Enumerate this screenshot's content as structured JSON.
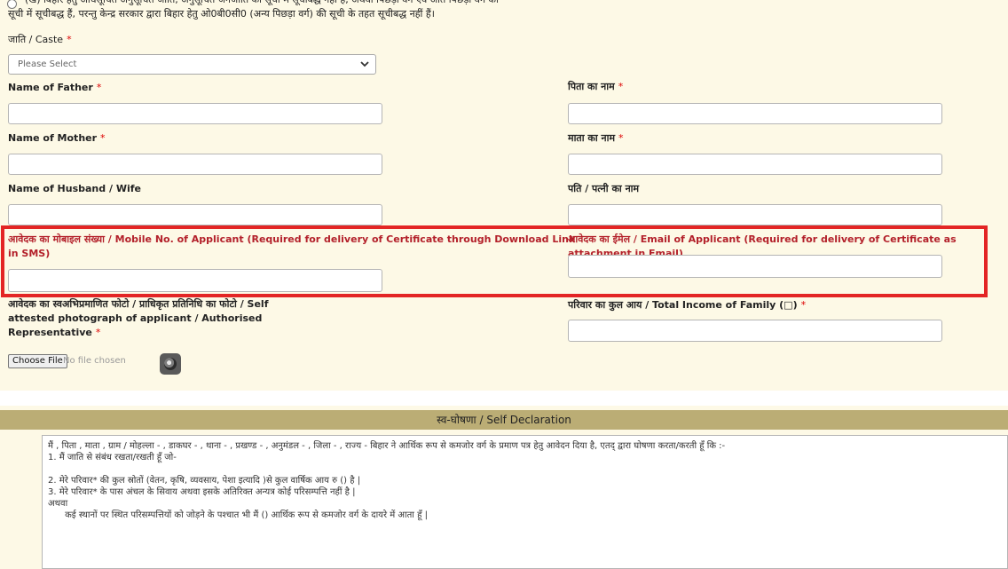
{
  "top_text": {
    "line1": "(ख) बिहार हेतु अधिसूचित अनुसूचित जाति, अनुसूचित जनजाति की सूची में सूचीबद्ध नहीं हैं, अथवा पिछड़ा वर्ग एवं अति पिछड़ा वर्ग की",
    "line2": "सूची में सूचीबद्ध हैं, परन्तु केन्द्र सरकार द्वारा बिहार हेतु ओ0बी0सी0 (अन्य पिछड़ा वर्ग) की सूची के तहत सूचीबद्ध नहीं हैं।"
  },
  "caste": {
    "label": "जाति / Caste",
    "required": "*",
    "placeholder": "Please Select"
  },
  "father": {
    "label_en": "Name of Father",
    "label_hi": "पिता का नाम",
    "required": "*",
    "value_en": "",
    "value_hi": ""
  },
  "mother": {
    "label_en": "Name of Mother",
    "label_hi": "माता का नाम",
    "required": "*",
    "value_en": "",
    "value_hi": ""
  },
  "spouse": {
    "label_en": "Name of Husband / Wife",
    "label_hi": "पति / पत्नी का नाम",
    "value_en": "",
    "value_hi": ""
  },
  "mobile": {
    "label_line1": "आवेदक का मोबाइल संख्या / Mobile No. of Applicant (Required for delivery of Certificate through Download Link",
    "label_line2": "in SMS)",
    "value": ""
  },
  "email": {
    "label": "आवेदक का ईमेल / Email of Applicant (Required for delivery of Certificate as attachment in Email)",
    "value": ""
  },
  "photo": {
    "label_line1": "आवेदक का स्वअभिप्रमाणित फोटो / प्राधिकृत प्रतिनिधि का फोटो / Self",
    "label_line2": "attested photograph of applicant / Authorised",
    "label_line3": "Representative",
    "required": "*",
    "choose_file": "Choose File",
    "no_file": "No file chosen"
  },
  "income": {
    "label": "परिवार का कुल आय / Total Income of Family (□)",
    "required": "*",
    "value": ""
  },
  "declaration": {
    "title": "स्व-घोषणा / Self Declaration",
    "lines": [
      "मैं , पिता , माता , ग्राम / मोहल्ला - , डाकघर - , थाना - , प्रखण्ड - , अनुमंडल - , जिला - , राज्य - बिहार ने आर्थिक रूप से कमजोर वर्ग के प्रमाण पत्र हेतु आवेदन दिया है, एतद् द्वारा घोषणा करता/करती हूँ कि :-",
      "1. मैं  जाति से संबंध रखता/रखती हूँ जो-",
      "",
      "2. मेरे परिवार* की कुल स्रोतों (वेतन, कृषि, व्यवसाय, पेशा इत्यादि )से कुल वार्षिक आय रु  () है |",
      "3. मेरे परिवार* के पास  अंचल के सिवाय अथवा इसके अतिरिक्त अन्यत्र कोई परिसम्पत्ति नहीं है |",
      "अथवा",
      "      कई स्थानों पर स्थित परिसम्पत्तियों को जोड़ने के पश्चात भी मैं () आर्थिक रूप से कमजोर वर्ग के दायरे में आता हूँ |"
    ]
  }
}
